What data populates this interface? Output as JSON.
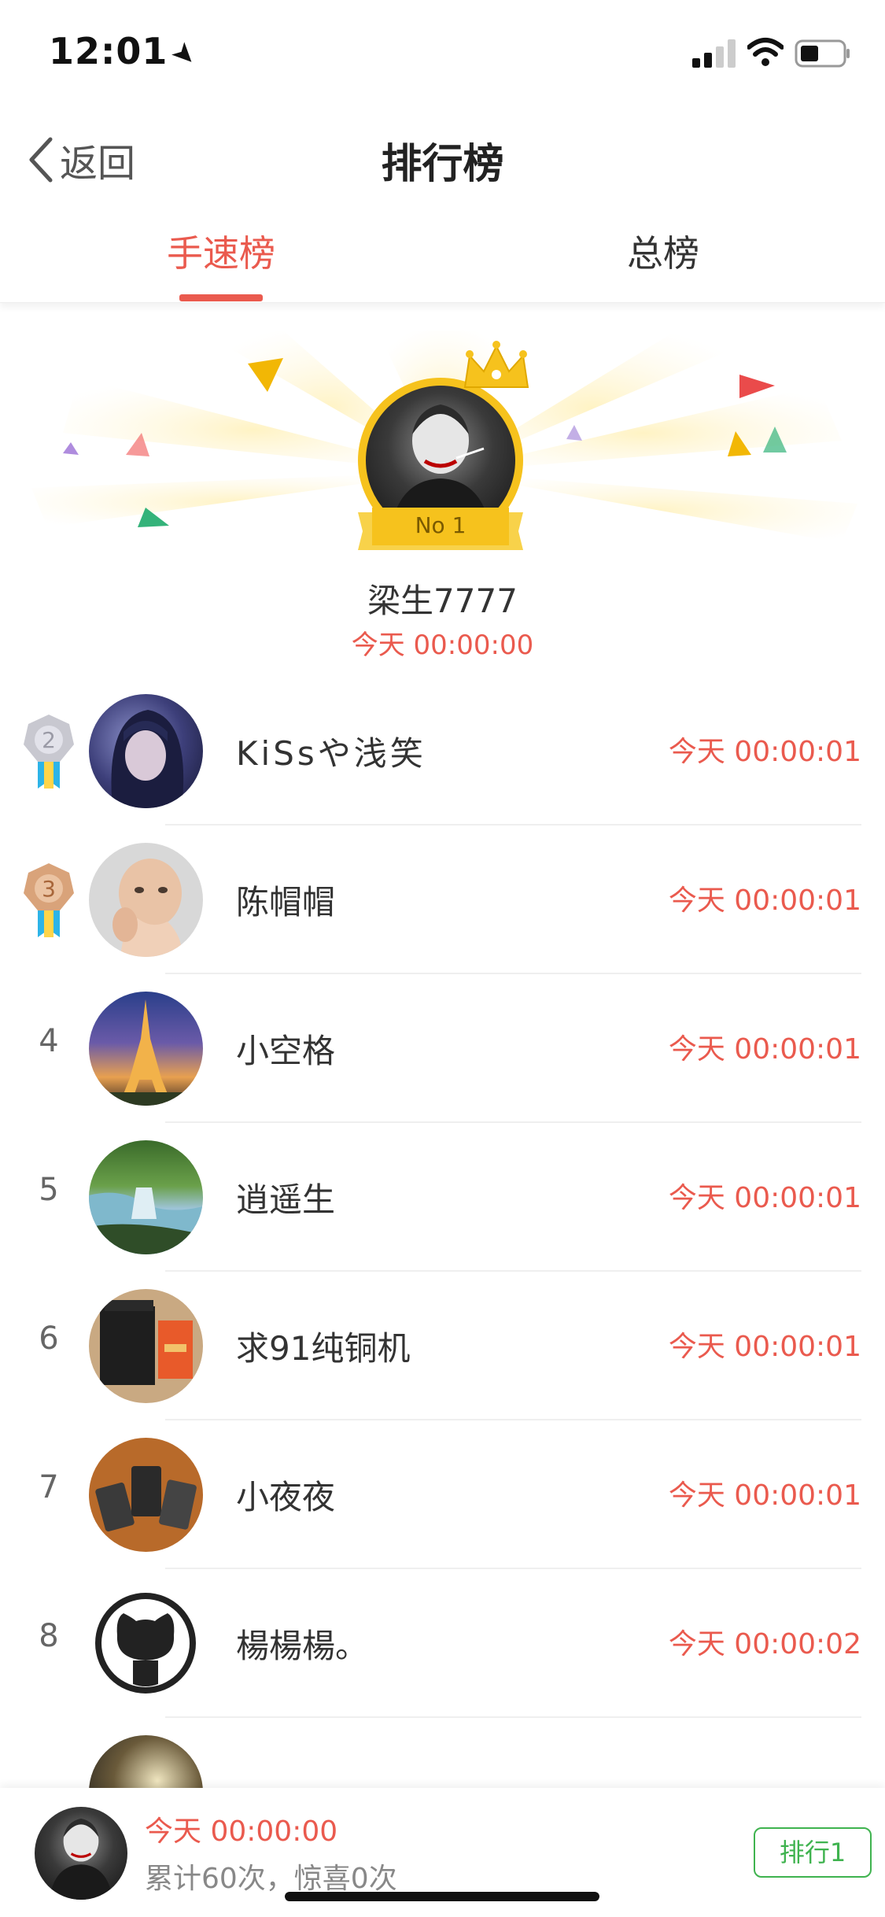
{
  "status_bar": {
    "time": "12:01"
  },
  "nav": {
    "back_label": "返回",
    "title": "排行榜"
  },
  "tabs": [
    {
      "label": "手速榜",
      "active": true
    },
    {
      "label": "总榜",
      "active": false
    }
  ],
  "champion": {
    "badge": "No 1",
    "name": "梁生7777",
    "time": "今天 00:00:00"
  },
  "rows": [
    {
      "rank": "2",
      "name": "KiSsや浅笑",
      "time": "今天 00:00:01",
      "medal": "silver"
    },
    {
      "rank": "3",
      "name": "陈帽帽",
      "time": "今天 00:00:01",
      "medal": "bronze"
    },
    {
      "rank": "4",
      "name": "小空格",
      "time": "今天 00:00:01"
    },
    {
      "rank": "5",
      "name": "逍遥生",
      "time": "今天 00:00:01"
    },
    {
      "rank": "6",
      "name": "求91纯铜机",
      "time": "今天 00:00:01"
    },
    {
      "rank": "7",
      "name": "小夜夜",
      "time": "今天 00:00:01"
    },
    {
      "rank": "8",
      "name": "楊楊楊。",
      "time": "今天 00:00:02"
    }
  ],
  "bottom": {
    "time": "今天 00:00:00",
    "stats": "累计60次，惊喜0次",
    "rank_button": "排行1"
  },
  "colors": {
    "accent": "#ea5a4e",
    "gold": "#f6c21d",
    "green": "#3fb34f"
  }
}
